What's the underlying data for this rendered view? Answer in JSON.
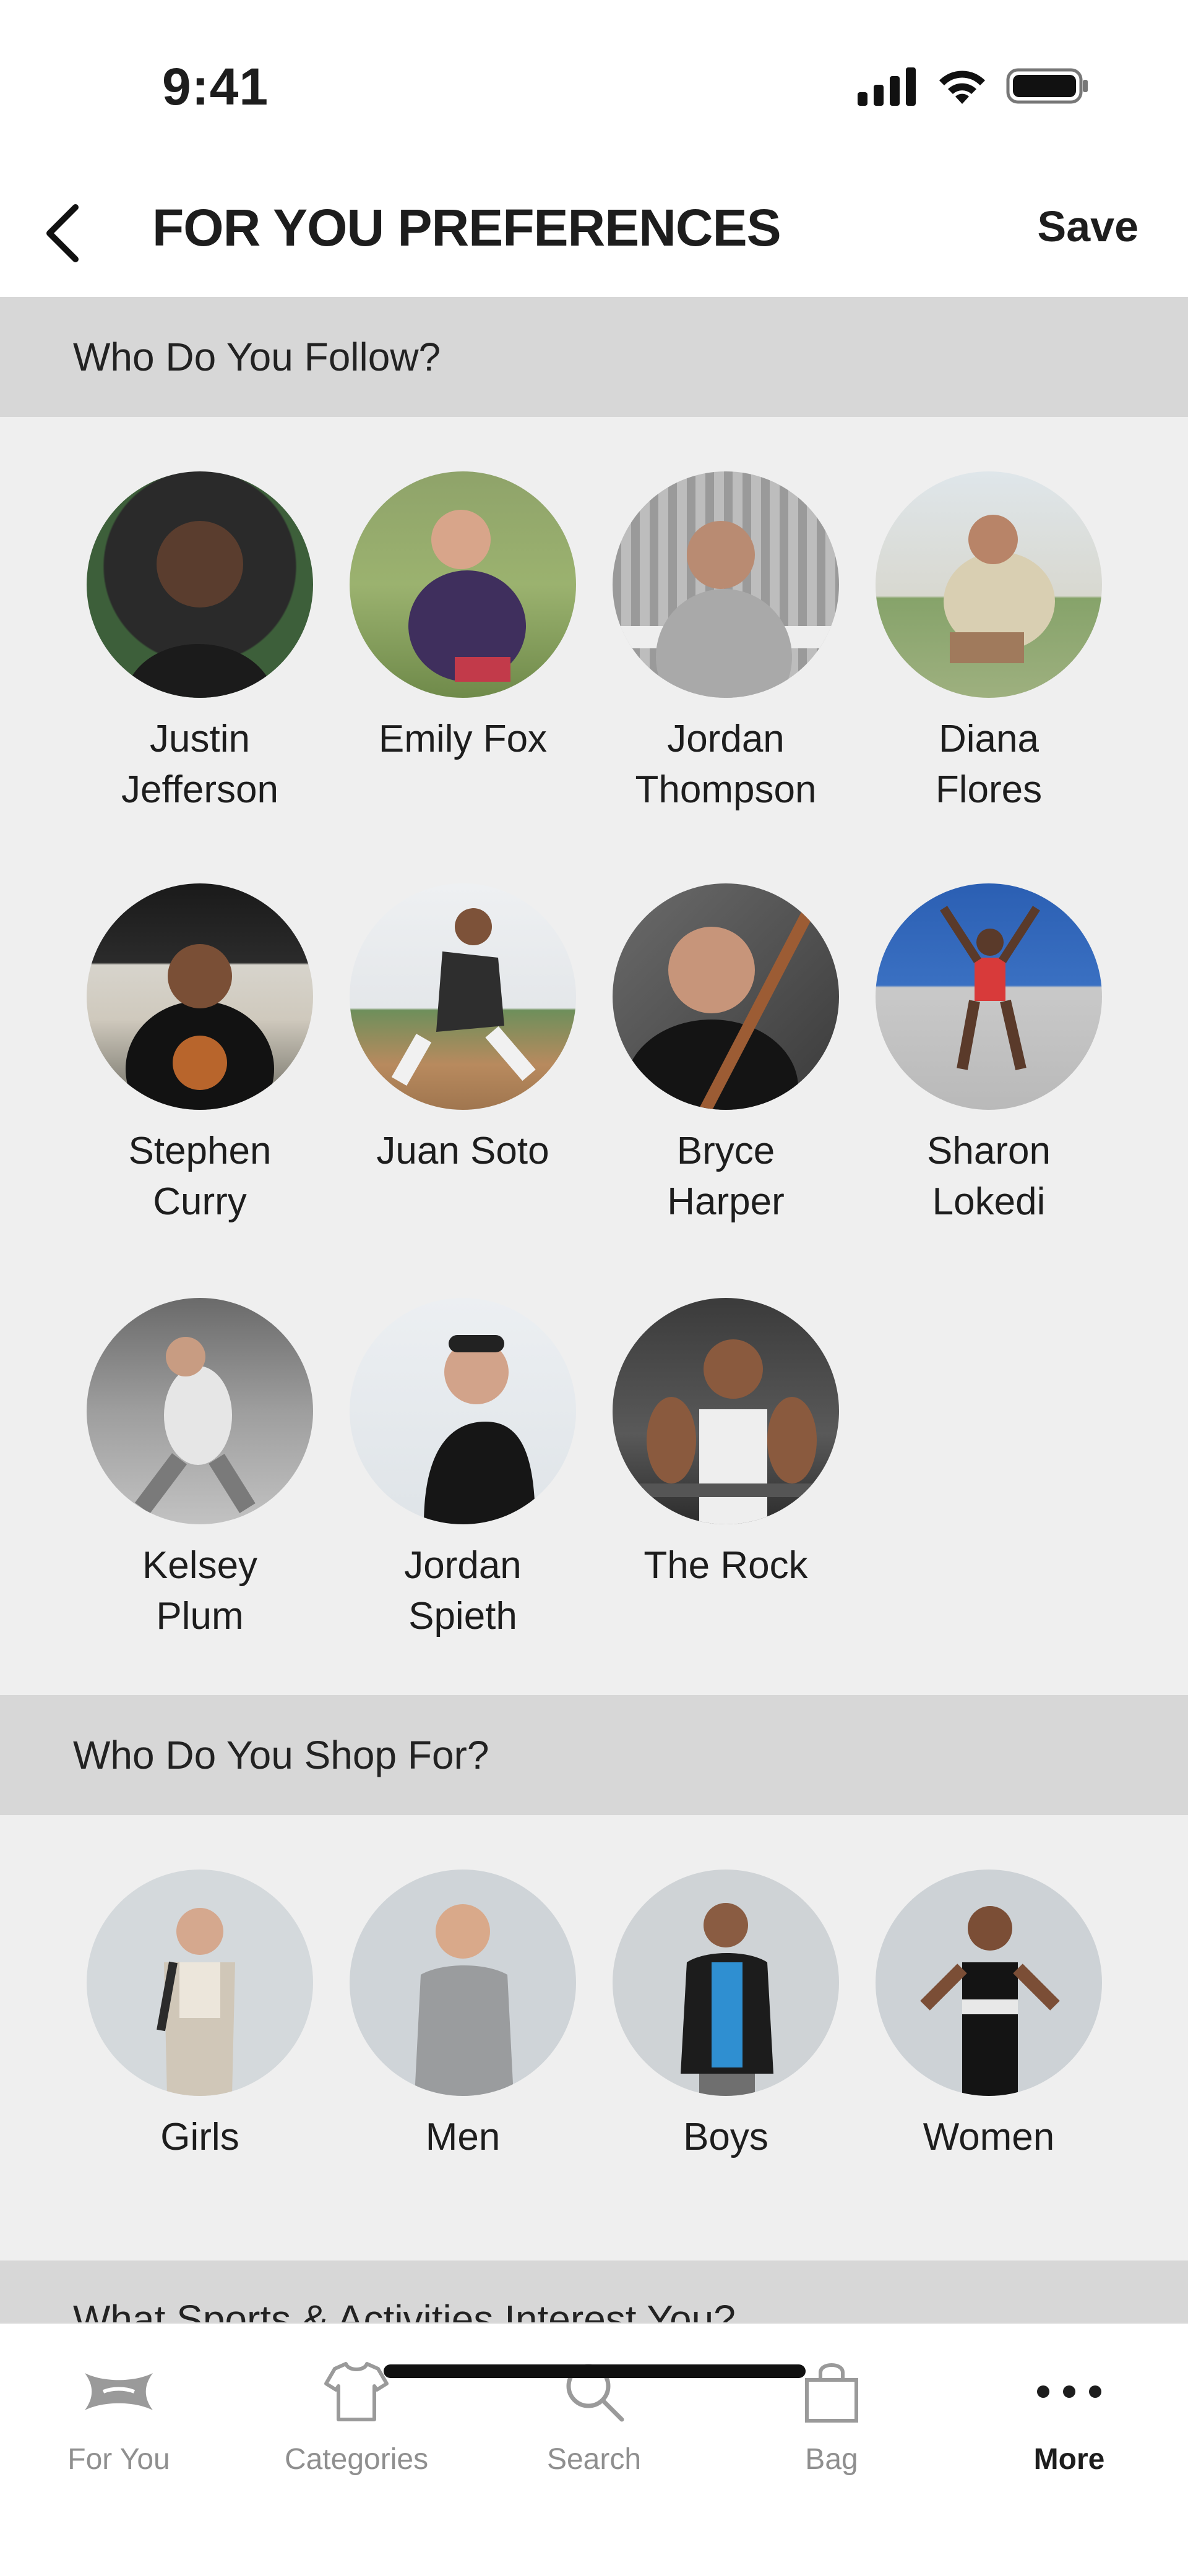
{
  "status_bar": {
    "time": "9:41"
  },
  "header": {
    "title": "FOR YOU PREFERENCES",
    "save_label": "Save"
  },
  "sections": {
    "follow": {
      "title": "Who Do You Follow?",
      "athletes": [
        {
          "name": "Justin\nJefferson"
        },
        {
          "name": "Emily Fox"
        },
        {
          "name": "Jordan\nThompson"
        },
        {
          "name": "Diana\nFlores"
        },
        {
          "name": "Stephen\nCurry"
        },
        {
          "name": "Juan Soto"
        },
        {
          "name": "Bryce\nHarper"
        },
        {
          "name": "Sharon\nLokedi"
        },
        {
          "name": "Kelsey\nPlum"
        },
        {
          "name": "Jordan\nSpieth"
        },
        {
          "name": "The Rock"
        }
      ]
    },
    "shop_for": {
      "title": "Who Do You Shop For?",
      "options": [
        {
          "label": "Girls"
        },
        {
          "label": "Men"
        },
        {
          "label": "Boys"
        },
        {
          "label": "Women"
        }
      ]
    },
    "sports": {
      "title": "What Sports & Activities Interest You?"
    }
  },
  "tab_bar": {
    "tabs": [
      {
        "label": "For You",
        "icon": "under-armour-logo-icon"
      },
      {
        "label": "Categories",
        "icon": "shirt-icon"
      },
      {
        "label": "Search",
        "icon": "search-icon"
      },
      {
        "label": "Bag",
        "icon": "bag-icon"
      },
      {
        "label": "More",
        "icon": "more-dots-icon"
      }
    ],
    "active_tab": "More"
  },
  "colors": {
    "section_header_bg": "#d7d7d7",
    "page_bg": "#efefef",
    "text_primary": "#1d1d1d",
    "tab_inactive": "#8f8f8f"
  }
}
